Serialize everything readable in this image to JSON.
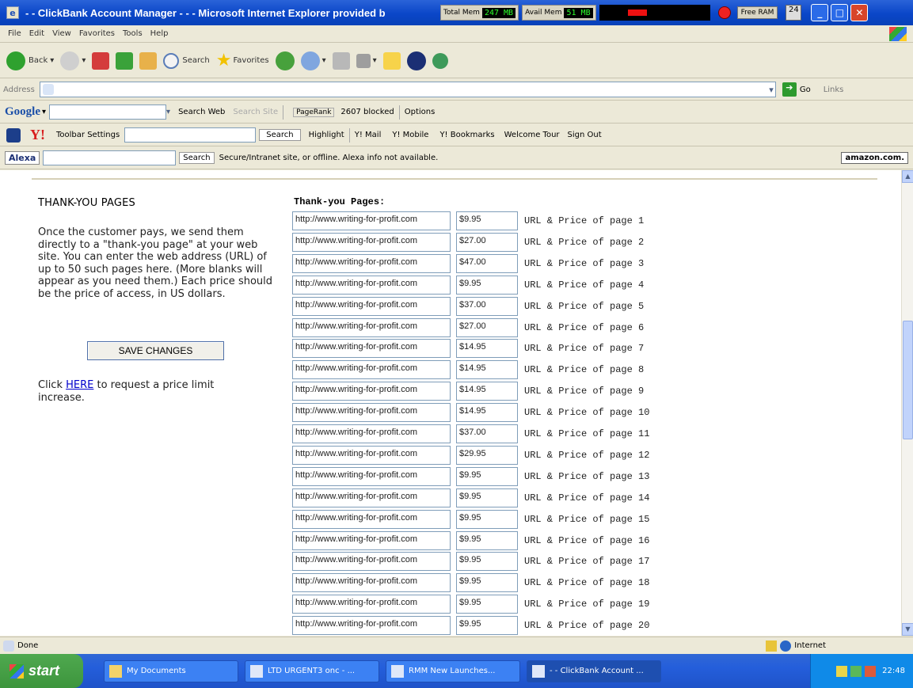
{
  "window": {
    "title": "- - ClickBank Account Manager - - - Microsoft Internet Explorer provided b",
    "total_mem_label": "Total Mem",
    "total_mem_value": "247 MB",
    "avail_mem_label": "Avail Mem",
    "avail_mem_value": "51 MB",
    "free_ram": "Free RAM",
    "mini_label": "24"
  },
  "menu": [
    "File",
    "Edit",
    "View",
    "Favorites",
    "Tools",
    "Help"
  ],
  "toolbar": {
    "back": "Back",
    "search": "Search",
    "favorites": "Favorites"
  },
  "address": {
    "label": "Address",
    "value": "",
    "go": "Go",
    "links": "Links"
  },
  "google": {
    "logo": "Google",
    "search_web": "Search Web",
    "search_site": "Search Site",
    "pagerank": "PageRank",
    "blocked": "2607 blocked",
    "options": "Options"
  },
  "yahoo": {
    "logo": "Y!",
    "toolbar_settings": "Toolbar Settings",
    "search": "Search",
    "highlight": "Highlight",
    "mail": "Y! Mail",
    "mobile": "Y! Mobile",
    "bookmarks": "Y! Bookmarks",
    "welcome": "Welcome Tour",
    "signout": "Sign Out"
  },
  "alexa": {
    "logo": "Alexa",
    "search": "Search",
    "status": "Secure/Intranet site, or offline. Alexa info not available.",
    "amazon": "amazon.com."
  },
  "page": {
    "heading": "THANK-YOU PAGES",
    "description": "Once the customer pays, we send them directly to a \"thank-you page\" at your web site. You can enter the web address (URL) of up to 50 such pages here. (More blanks will appear as you need them.) Each price should be the price of access, in US dollars.",
    "save_button": "SAVE CHANGES",
    "click_prefix": "Click ",
    "here_link": "HERE",
    "click_suffix": " to request a price limit increase.",
    "ty_header": "Thank-you Pages:",
    "rows": [
      {
        "url": "http://www.writing-for-profit.com",
        "price": "$9.95",
        "label": "URL & Price of page 1"
      },
      {
        "url": "http://www.writing-for-profit.com",
        "price": "$27.00",
        "label": "URL & Price of page 2"
      },
      {
        "url": "http://www.writing-for-profit.com",
        "price": "$47.00",
        "label": "URL & Price of page 3"
      },
      {
        "url": "http://www.writing-for-profit.com",
        "price": "$9.95",
        "label": "URL & Price of page 4"
      },
      {
        "url": "http://www.writing-for-profit.com",
        "price": "$37.00",
        "label": "URL & Price of page 5"
      },
      {
        "url": "http://www.writing-for-profit.com",
        "price": "$27.00",
        "label": "URL & Price of page 6"
      },
      {
        "url": "http://www.writing-for-profit.com",
        "price": "$14.95",
        "label": "URL & Price of page 7"
      },
      {
        "url": "http://www.writing-for-profit.com",
        "price": "$14.95",
        "label": "URL & Price of page 8"
      },
      {
        "url": "http://www.writing-for-profit.com",
        "price": "$14.95",
        "label": "URL & Price of page 9"
      },
      {
        "url": "http://www.writing-for-profit.com",
        "price": "$14.95",
        "label": "URL & Price of page 10"
      },
      {
        "url": "http://www.writing-for-profit.com",
        "price": "$37.00",
        "label": "URL & Price of page 11"
      },
      {
        "url": "http://www.writing-for-profit.com",
        "price": "$29.95",
        "label": "URL & Price of page 12"
      },
      {
        "url": "http://www.writing-for-profit.com",
        "price": "$9.95",
        "label": "URL & Price of page 13"
      },
      {
        "url": "http://www.writing-for-profit.com",
        "price": "$9.95",
        "label": "URL & Price of page 14"
      },
      {
        "url": "http://www.writing-for-profit.com",
        "price": "$9.95",
        "label": "URL & Price of page 15"
      },
      {
        "url": "http://www.writing-for-profit.com",
        "price": "$9.95",
        "label": "URL & Price of page 16"
      },
      {
        "url": "http://www.writing-for-profit.com",
        "price": "$9.95",
        "label": "URL & Price of page 17"
      },
      {
        "url": "http://www.writing-for-profit.com",
        "price": "$9.95",
        "label": "URL & Price of page 18"
      },
      {
        "url": "http://www.writing-for-profit.com",
        "price": "$9.95",
        "label": "URL & Price of page 19"
      },
      {
        "url": "http://www.writing-for-profit.com",
        "price": "$9.95",
        "label": "URL & Price of page 20"
      }
    ]
  },
  "status": {
    "text": "Done",
    "zone": "Internet"
  },
  "taskbar": {
    "start": "start",
    "tasks": [
      "My Documents",
      "LTD URGENT3 onc - ...",
      "RMM New Launches...",
      "- - ClickBank Account ..."
    ],
    "clock": "22:48"
  }
}
